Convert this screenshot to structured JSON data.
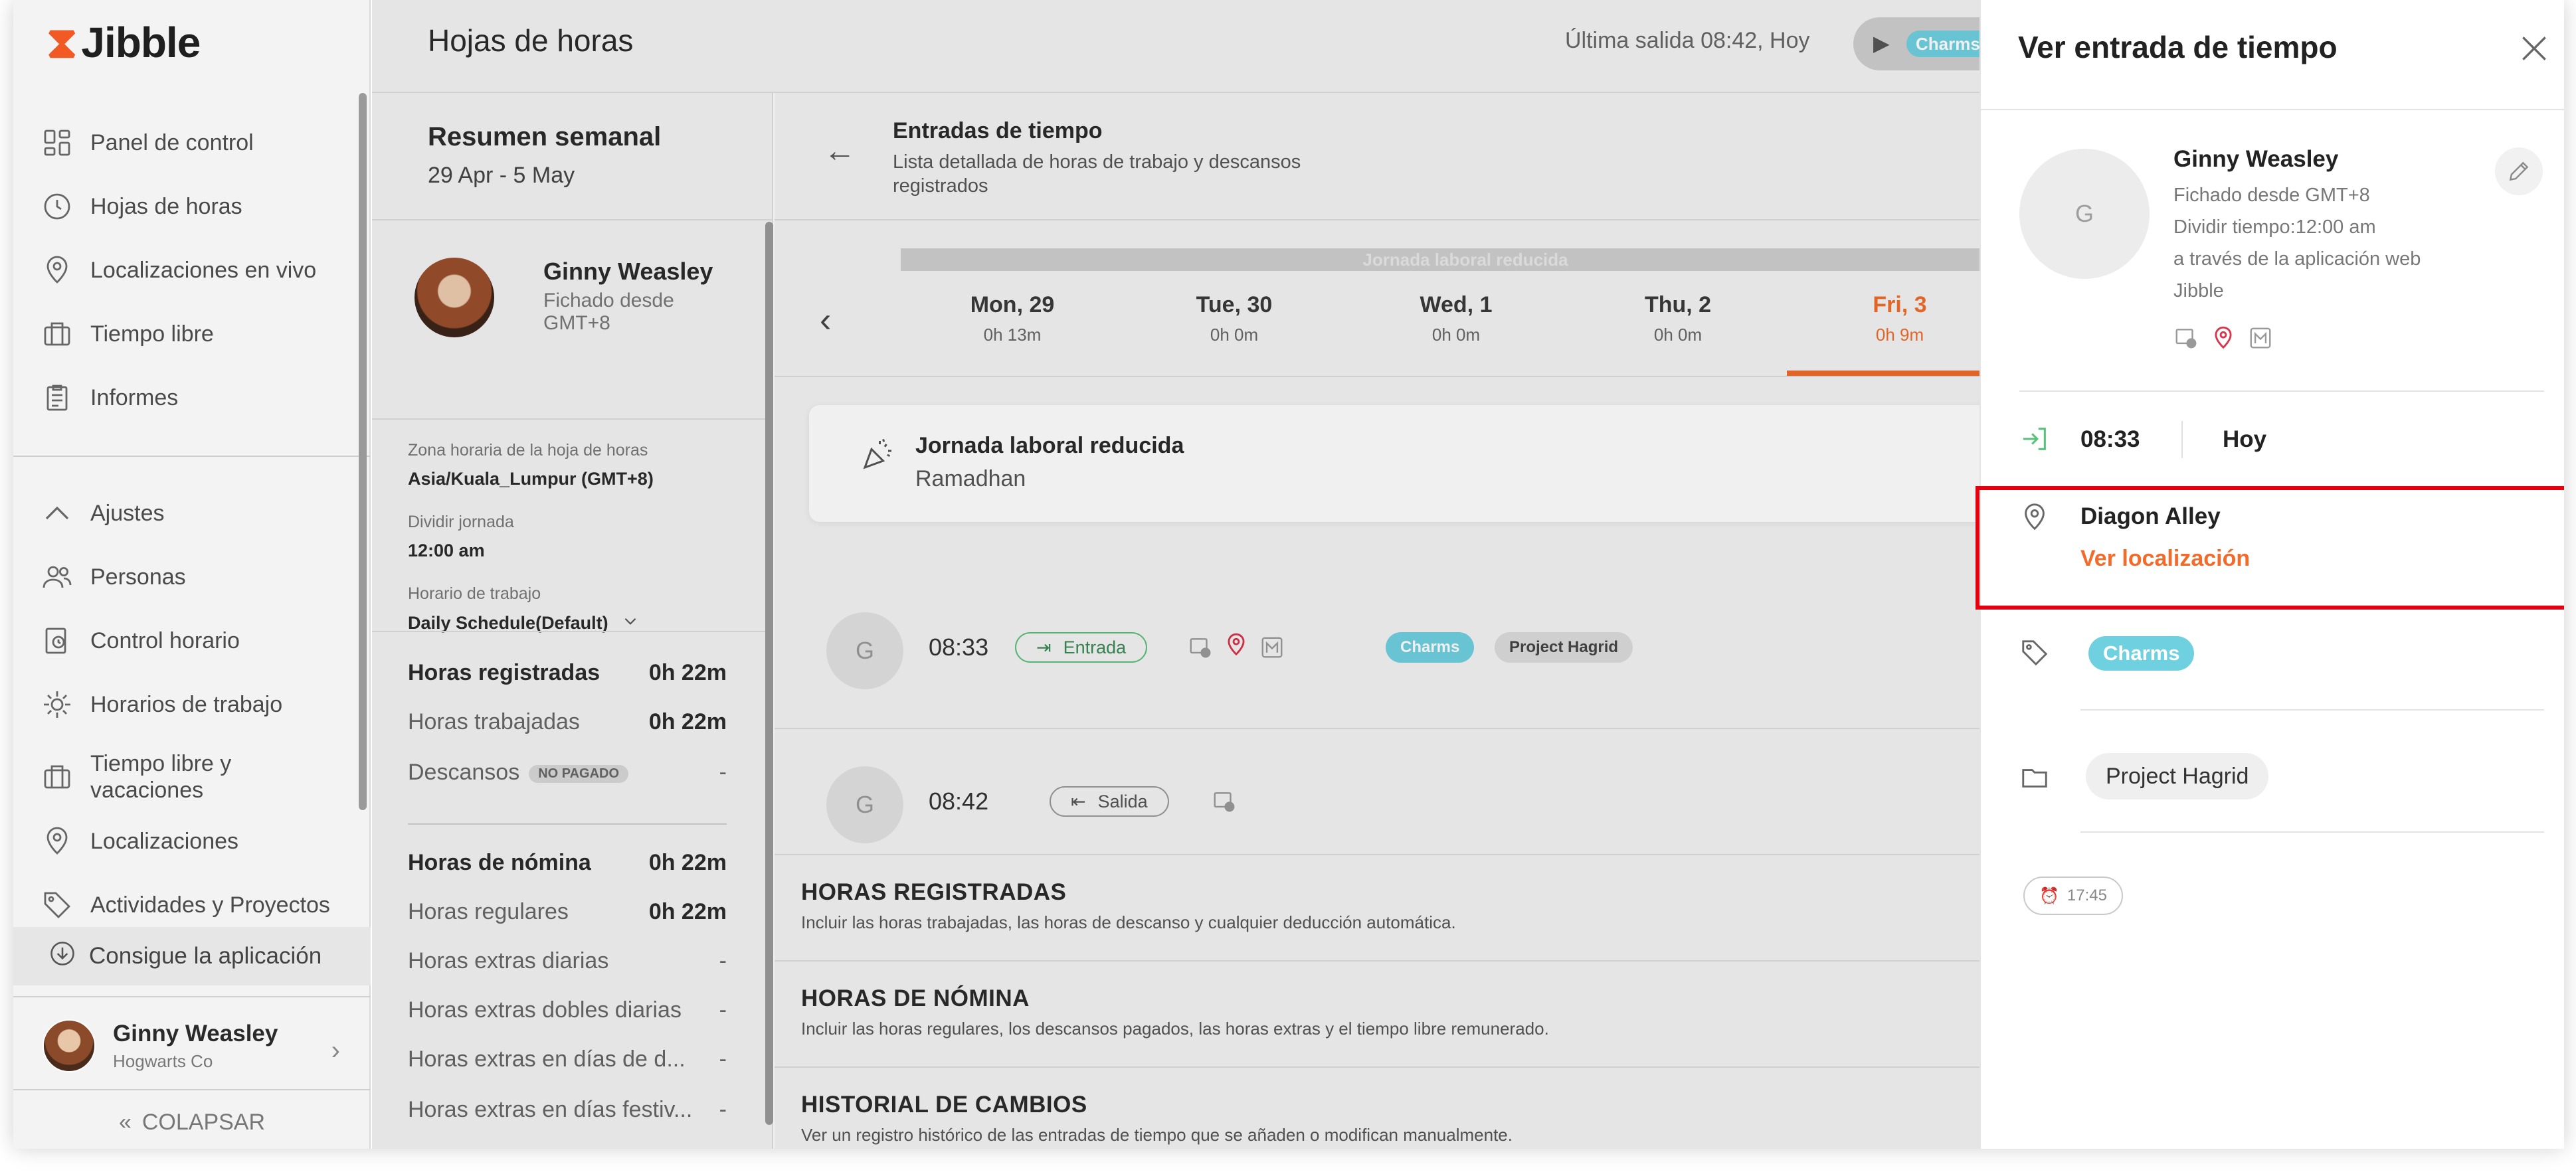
{
  "app": {
    "logo_text": "Jibble",
    "page_title": "Hojas de horas",
    "last_clock_out": "Última salida 08:42, Hoy",
    "timer_tag": "Charms"
  },
  "sidebar": {
    "items": [
      {
        "label": "Panel de control",
        "icon": "dashboard-icon"
      },
      {
        "label": "Hojas de horas",
        "icon": "clock-icon"
      },
      {
        "label": "Localizaciones en vivo",
        "icon": "location-pin-icon"
      },
      {
        "label": "Tiempo libre",
        "icon": "briefcase-icon"
      },
      {
        "label": "Informes",
        "icon": "report-icon"
      }
    ],
    "settings_label": "Ajustes",
    "settings_items": [
      {
        "label": "Personas",
        "icon": "people-icon"
      },
      {
        "label": "Control horario",
        "icon": "time-tracking-icon"
      },
      {
        "label": "Horarios de trabajo",
        "icon": "schedule-icon"
      },
      {
        "label": "Tiempo libre y vacaciones",
        "icon": "briefcase-icon"
      },
      {
        "label": "Localizaciones",
        "icon": "location-pin-icon"
      },
      {
        "label": "Actividades y Proyectos",
        "icon": "tag-icon"
      }
    ],
    "get_app": "Consigue la aplicación",
    "user_name": "Ginny Weasley",
    "user_org": "Hogwarts Co",
    "collapse": "COLAPSAR"
  },
  "summary": {
    "title": "Resumen semanal",
    "range": "29 Apr - 5 May",
    "name": "Ginny Weasley",
    "sub": "Fichado desde GMT+8",
    "tz_label": "Zona horaria de la hoja de horas",
    "tz_value": "Asia/Kuala_Lumpur (GMT+8)",
    "split_label": "Dividir jornada",
    "split_value": "12:00 am",
    "schedule_label": "Horario de trabajo",
    "schedule_value": "Daily Schedule(Default)",
    "registered": {
      "label": "Horas registradas",
      "value": "0h 22m"
    },
    "worked": {
      "label": "Horas trabajadas",
      "value": "0h 22m"
    },
    "breaks": {
      "label": "Descansos",
      "badge": "NO PAGADO",
      "value": "-"
    },
    "payroll": {
      "label": "Horas de nómina",
      "value": "0h 22m"
    },
    "regular": {
      "label": "Horas regulares",
      "value": "0h 22m"
    },
    "daily_ot": {
      "label": "Horas extras diarias",
      "value": "-"
    },
    "double_ot": {
      "label": "Horas extras dobles diarias",
      "value": "-"
    },
    "rest_ot": {
      "label": "Horas extras en días de d...",
      "value": "-"
    },
    "holiday_ot": {
      "label": "Horas extras en días festiv...",
      "value": "-"
    }
  },
  "entries": {
    "title": "Entradas de tiempo",
    "subtitle": "Lista detallada de horas de trabajo y descansos registrados",
    "reduced_banner": "Jornada laboral reducida",
    "days": [
      {
        "name": "Mon, 29",
        "time": "0h 13m"
      },
      {
        "name": "Tue, 30",
        "time": "0h 0m"
      },
      {
        "name": "Wed, 1",
        "time": "0h 0m"
      },
      {
        "name": "Thu, 2",
        "time": "0h 0m"
      },
      {
        "name": "Fri, 3",
        "time": "0h 9m"
      }
    ],
    "notice_title": "Jornada laboral reducida",
    "notice_sub": "Ramadhan",
    "row1": {
      "avatar": "G",
      "time": "08:33",
      "type": "Entrada",
      "tag": "Charms",
      "project": "Project Hagrid"
    },
    "row2": {
      "avatar": "G",
      "time": "08:42",
      "type": "Salida"
    },
    "sections": [
      {
        "title": "HORAS REGISTRADAS",
        "sub": "Incluir las horas trabajadas, las horas de descanso y cualquier deducción automática."
      },
      {
        "title": "HORAS DE NÓMINA",
        "sub": "Incluir las horas regulares, los descansos pagados, las horas extras y el tiempo libre remunerado."
      },
      {
        "title": "HISTORIAL DE CAMBIOS",
        "sub": "Ver un registro histórico de las entradas de tiempo que se añaden o modifican manualmente."
      }
    ]
  },
  "drawer": {
    "title": "Ver entrada de tiempo",
    "avatar": "G",
    "name": "Ginny Weasley",
    "line1": "Fichado desde GMT+8",
    "line2": "Dividir tiempo:12:00 am",
    "line3": "a través de la aplicación web",
    "line4": "Jibble",
    "time": "08:33",
    "day": "Hoy",
    "location_name": "Diagon Alley",
    "location_link": "Ver localización",
    "tag": "Charms",
    "project": "Project Hagrid",
    "break_time": "17:45"
  },
  "colors": {
    "accent": "#f26b2a",
    "charms": "#6fd0e0",
    "clock_in": "#5ac17a",
    "highlight": "#e4000f"
  }
}
